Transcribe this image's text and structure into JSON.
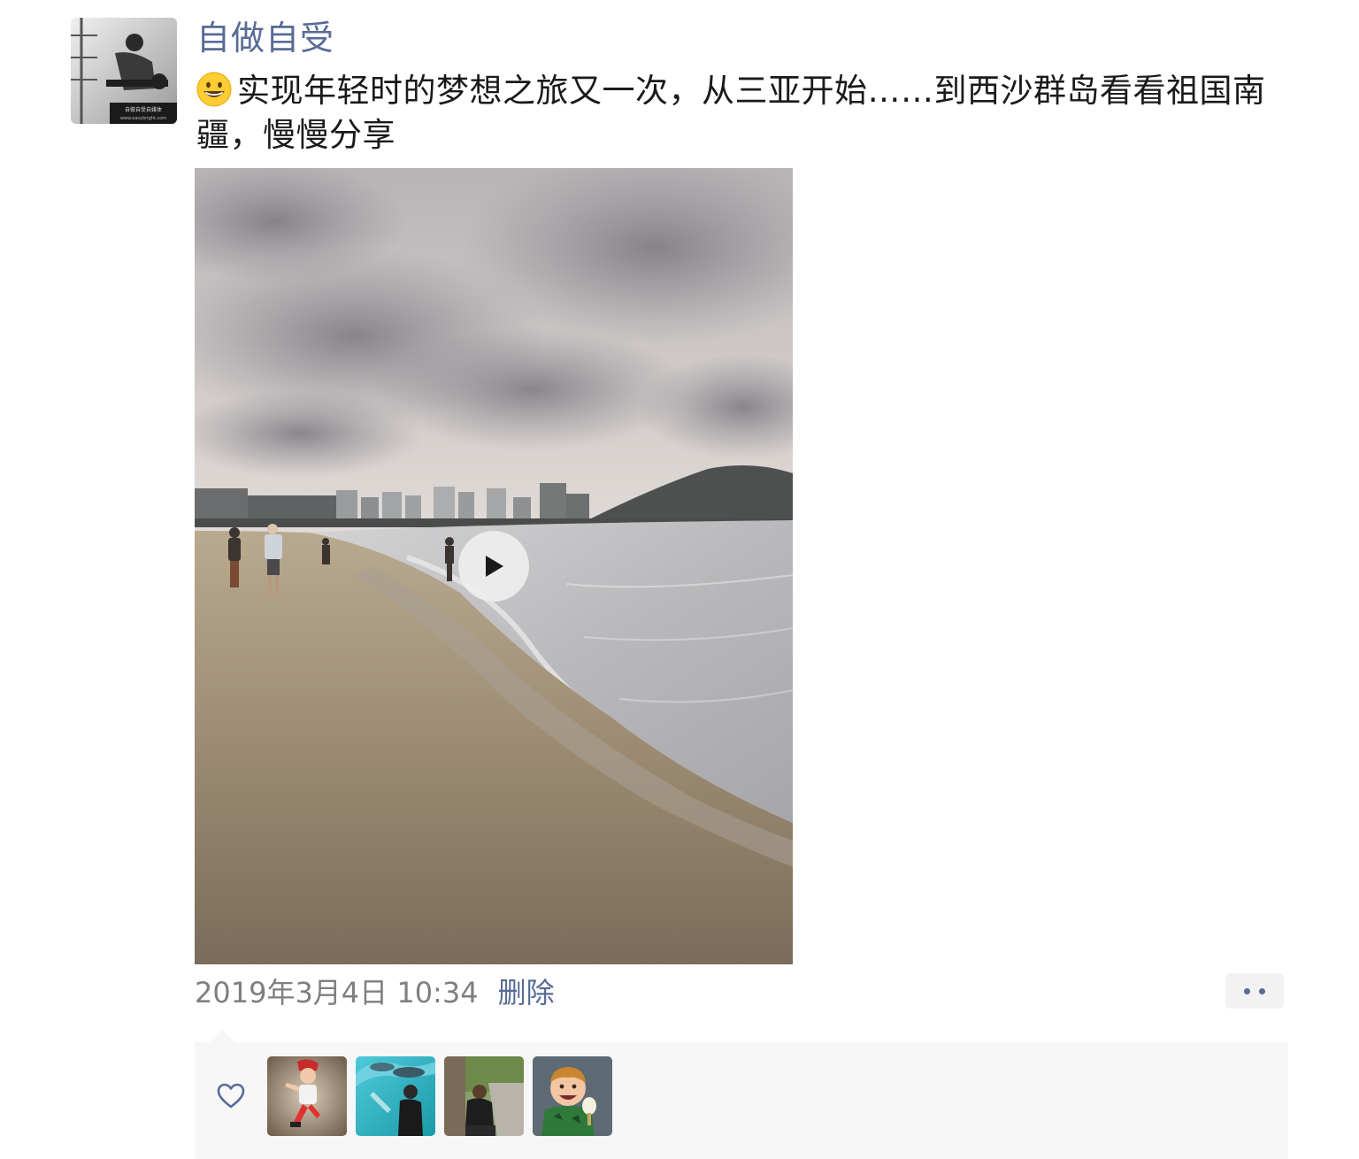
{
  "post": {
    "username": "自做自受",
    "text": "实现年轻时的梦想之旅又一次，从三亚开始……到西沙群岛看看祖国南疆，慢慢分享",
    "emoji": "grinning-face-emoji",
    "timestamp": "2019年3月4日 10:34",
    "delete_label": "删除",
    "avatar_caption": "自做自受自媒体",
    "avatar_url_text": "www.easybright.com"
  },
  "media": {
    "type": "video",
    "play_icon": "play-icon"
  },
  "likes": {
    "icon": "heart-outline-icon",
    "users": [
      {
        "name": "liker-1"
      },
      {
        "name": "liker-2"
      },
      {
        "name": "liker-3"
      },
      {
        "name": "liker-4"
      }
    ]
  },
  "colors": {
    "link": "#576b95",
    "text": "#1a1a1a",
    "muted": "#7f7f7f",
    "panel": "#f7f7f7"
  }
}
